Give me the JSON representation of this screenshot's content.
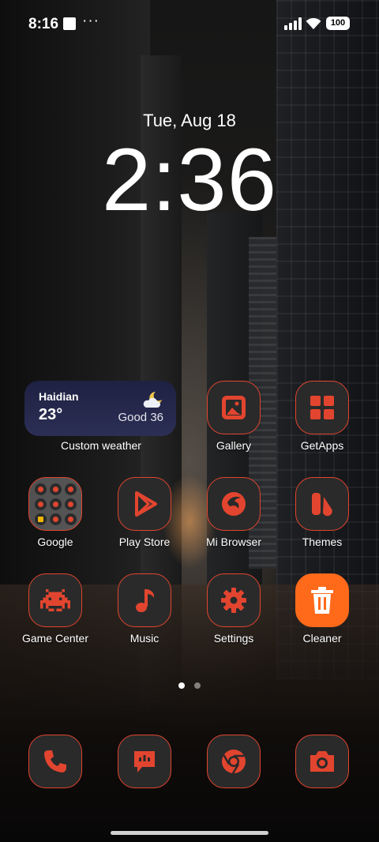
{
  "status_bar": {
    "time": "8:16",
    "overflow": "···",
    "battery": "100",
    "icons": [
      "notification-square-icon",
      "signal-icon",
      "wifi-icon",
      "battery-icon"
    ]
  },
  "lockclock": {
    "date": "Tue, Aug 18",
    "time": "2:36"
  },
  "weather": {
    "city": "Haidian",
    "temp": "23°",
    "aqi": "Good 36",
    "label": "Custom weather",
    "icon": "partly-cloudy-night-icon"
  },
  "apps": [
    {
      "name": "gallery",
      "label": "Gallery"
    },
    {
      "name": "getapps",
      "label": "GetApps"
    },
    {
      "name": "google",
      "label": "Google"
    },
    {
      "name": "play-store",
      "label": "Play Store"
    },
    {
      "name": "mi-browser",
      "label": "Mi Browser"
    },
    {
      "name": "themes",
      "label": "Themes"
    },
    {
      "name": "game-center",
      "label": "Game Center"
    },
    {
      "name": "music",
      "label": "Music"
    },
    {
      "name": "settings",
      "label": "Settings"
    },
    {
      "name": "cleaner",
      "label": "Cleaner"
    }
  ],
  "dock": [
    "phone-icon",
    "messages-icon",
    "chrome-icon",
    "camera-icon"
  ],
  "page_indicator": {
    "current": 1,
    "total": 2
  },
  "colors": {
    "accent": "#e2452f",
    "tile": "#2a2a2a",
    "cleaner": "#ff6a1a",
    "weather_bg": "#23264a"
  }
}
